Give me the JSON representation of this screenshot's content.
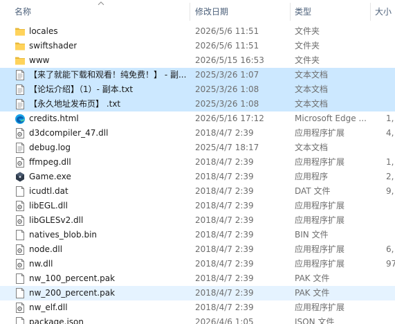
{
  "columns": {
    "name": "名称",
    "modified": "修改日期",
    "type": "类型",
    "size": "大小"
  },
  "files": [
    {
      "name": "locales",
      "date": "2026/5/6 11:51",
      "type": "文件夹",
      "size": "",
      "icon": "folder-icon",
      "state": ""
    },
    {
      "name": "swiftshader",
      "date": "2026/5/6 11:51",
      "type": "文件夹",
      "size": "",
      "icon": "folder-icon",
      "state": ""
    },
    {
      "name": "www",
      "date": "2026/5/15 16:53",
      "type": "文件夹",
      "size": "",
      "icon": "folder-icon",
      "state": ""
    },
    {
      "name": "【来了就能下载和观看！纯免费！】 - 副...",
      "date": "2025/3/26 1:07",
      "type": "文本文档",
      "size": "",
      "icon": "text-file-icon",
      "state": "selected"
    },
    {
      "name": "【论坛介绍】（1）- 副本.txt",
      "date": "2025/3/26 1:08",
      "type": "文本文档",
      "size": "",
      "icon": "text-file-icon",
      "state": "selected"
    },
    {
      "name": "【永久地址发布页】 .txt",
      "date": "2025/3/26 1:08",
      "type": "文本文档",
      "size": "",
      "icon": "text-file-icon",
      "state": "selected"
    },
    {
      "name": "credits.html",
      "date": "2026/5/16 17:12",
      "type": "Microsoft Edge ...",
      "size": "1,",
      "icon": "edge-icon",
      "state": ""
    },
    {
      "name": "d3dcompiler_47.dll",
      "date": "2018/4/7 2:39",
      "type": "应用程序扩展",
      "size": "4,",
      "icon": "dll-file-icon",
      "state": ""
    },
    {
      "name": "debug.log",
      "date": "2025/4/7 18:17",
      "type": "文本文档",
      "size": "",
      "icon": "text-file-icon",
      "state": ""
    },
    {
      "name": "ffmpeg.dll",
      "date": "2018/4/7 2:39",
      "type": "应用程序扩展",
      "size": "1,",
      "icon": "dll-file-icon",
      "state": ""
    },
    {
      "name": "Game.exe",
      "date": "2018/4/7 2:39",
      "type": "应用程序",
      "size": "2,",
      "icon": "game-exe-icon",
      "state": ""
    },
    {
      "name": "icudtl.dat",
      "date": "2018/4/7 2:39",
      "type": "DAT 文件",
      "size": "9,",
      "icon": "blank-file-icon",
      "state": ""
    },
    {
      "name": "libEGL.dll",
      "date": "2018/4/7 2:39",
      "type": "应用程序扩展",
      "size": "",
      "icon": "dll-file-icon",
      "state": ""
    },
    {
      "name": "libGLESv2.dll",
      "date": "2018/4/7 2:39",
      "type": "应用程序扩展",
      "size": "",
      "icon": "dll-file-icon",
      "state": ""
    },
    {
      "name": "natives_blob.bin",
      "date": "2018/4/7 2:39",
      "type": "BIN 文件",
      "size": "",
      "icon": "blank-file-icon",
      "state": ""
    },
    {
      "name": "node.dll",
      "date": "2018/4/7 2:39",
      "type": "应用程序扩展",
      "size": "6,",
      "icon": "dll-file-icon",
      "state": ""
    },
    {
      "name": "nw.dll",
      "date": "2018/4/7 2:39",
      "type": "应用程序扩展",
      "size": "97,",
      "icon": "dll-file-icon",
      "state": ""
    },
    {
      "name": "nw_100_percent.pak",
      "date": "2018/4/7 2:39",
      "type": "PAK 文件",
      "size": "",
      "icon": "blank-file-icon",
      "state": ""
    },
    {
      "name": "nw_200_percent.pak",
      "date": "2018/4/7 2:39",
      "type": "PAK 文件",
      "size": "",
      "icon": "blank-file-icon",
      "state": "hover"
    },
    {
      "name": "nw_elf.dll",
      "date": "2018/4/7 2:39",
      "type": "应用程序扩展",
      "size": "",
      "icon": "dll-file-icon",
      "state": ""
    },
    {
      "name": "package.json",
      "date": "2026/4/6 1:05",
      "type": "JSON 文件",
      "size": "",
      "icon": "blank-file-icon",
      "state": ""
    }
  ],
  "colors": {
    "selected_row": "#cce8ff",
    "hover_row": "#e5f3ff",
    "header_text": "#4c607a",
    "folder": "#ffd35b"
  }
}
